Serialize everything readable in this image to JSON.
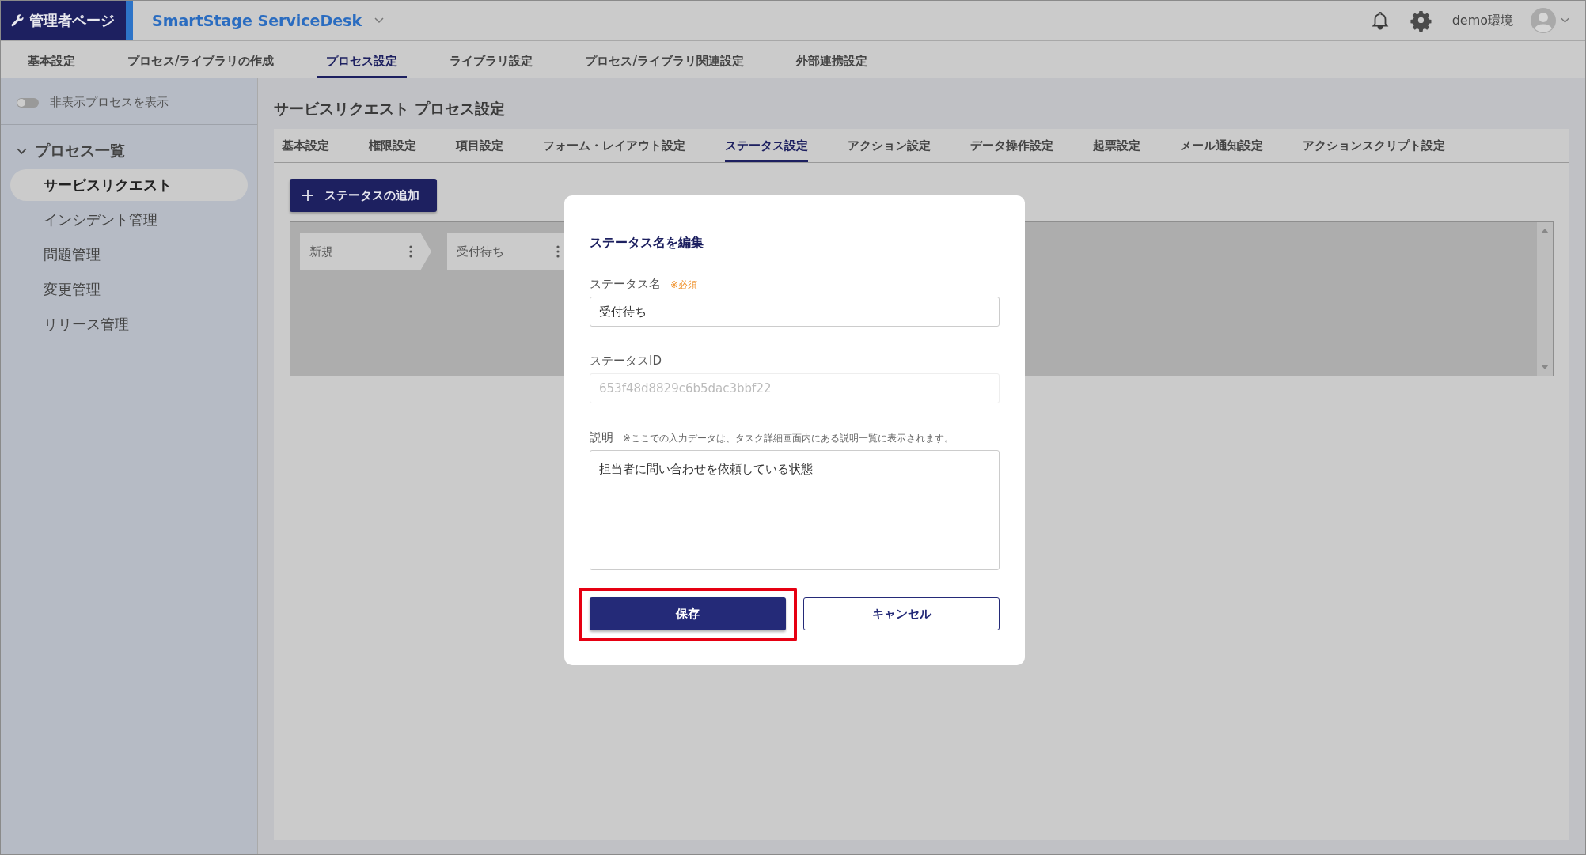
{
  "header": {
    "admin_label": "管理者ページ",
    "product": "SmartStage ServiceDesk",
    "environment": "demo環境"
  },
  "main_tabs": [
    {
      "label": "基本設定",
      "selected": false
    },
    {
      "label": "プロセス/ライブラリの作成",
      "selected": false
    },
    {
      "label": "プロセス設定",
      "selected": true
    },
    {
      "label": "ライブラリ設定",
      "selected": false
    },
    {
      "label": "プロセス/ライブラリ関連設定",
      "selected": false
    },
    {
      "label": "外部連携設定",
      "selected": false
    }
  ],
  "sidebar": {
    "toggle": {
      "label": "非表示プロセスを表示",
      "on": false
    },
    "section": {
      "label": "プロセス一覧",
      "expanded": true
    },
    "items": [
      {
        "label": "サービスリクエスト",
        "selected": true
      },
      {
        "label": "インシデント管理",
        "selected": false
      },
      {
        "label": "問題管理",
        "selected": false
      },
      {
        "label": "変更管理",
        "selected": false
      },
      {
        "label": "リリース管理",
        "selected": false
      }
    ]
  },
  "page_title": "サービスリクエスト プロセス設定",
  "sub_tabs": [
    {
      "label": "基本設定",
      "selected": false
    },
    {
      "label": "権限設定",
      "selected": false
    },
    {
      "label": "項目設定",
      "selected": false
    },
    {
      "label": "フォーム・レイアウト設定",
      "selected": false
    },
    {
      "label": "ステータス設定",
      "selected": true
    },
    {
      "label": "アクション設定",
      "selected": false
    },
    {
      "label": "データ操作設定",
      "selected": false
    },
    {
      "label": "起票設定",
      "selected": false
    },
    {
      "label": "メール通知設定",
      "selected": false
    },
    {
      "label": "アクションスクリプト設定",
      "selected": false
    }
  ],
  "add_button": "ステータスの追加",
  "statuses": [
    {
      "label": "新規"
    },
    {
      "label": "受付待ち"
    }
  ],
  "dialog": {
    "title": "ステータス名を編集",
    "fields": [
      {
        "kind": "input",
        "label": "ステータス名",
        "note": "※必須",
        "value": "受付待ち",
        "disabled": false
      },
      {
        "kind": "input",
        "label": "ステータスID",
        "value": "653f48d8829c6b5dac3bbf22",
        "disabled": true
      },
      {
        "kind": "textarea",
        "label": "説明",
        "note": "※ここでの入力データは、タスク詳細画面内にある説明一覧に表示されます。",
        "value": "担当者に問い合わせを依頼している状態",
        "disabled": false
      }
    ],
    "buttons": [
      {
        "kind": "primary",
        "label": "保存",
        "highlighted": true
      },
      {
        "kind": "secondary",
        "label": "キャンセル",
        "highlighted": false
      }
    ]
  }
}
